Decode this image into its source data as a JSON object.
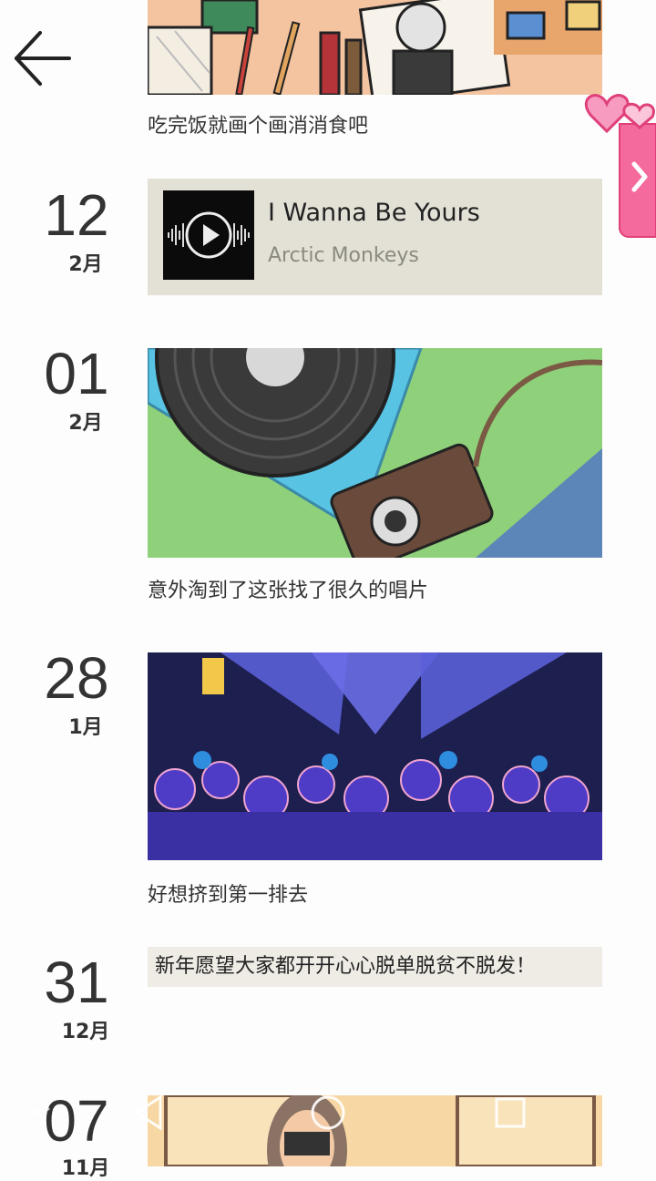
{
  "entries": [
    {
      "caption": "吃完饭就画个画消消食吧"
    },
    {
      "day": "12",
      "month": "2月",
      "song_title": "I Wanna Be Yours",
      "song_artist": "Arctic Monkeys"
    },
    {
      "day": "01",
      "month": "2月",
      "caption": "意外淘到了这张找了很久的唱片"
    },
    {
      "day": "28",
      "month": "1月",
      "caption": "好想挤到第一排去"
    },
    {
      "day": "31",
      "month": "12月",
      "text": "新年愿望大家都开开心心脱单脱贫不脱发！"
    },
    {
      "day": "07",
      "month": "11月"
    }
  ],
  "icons": {
    "back": "arrow-left-icon",
    "side_tab": "chevron-right-icon",
    "nav": [
      "back-triangle-icon",
      "home-circle-icon",
      "recents-square-icon"
    ]
  },
  "colors": {
    "accent_pink": "#f05a8c",
    "music_card_bg": "#e3e0d6",
    "text_card_bg": "#efece6"
  }
}
